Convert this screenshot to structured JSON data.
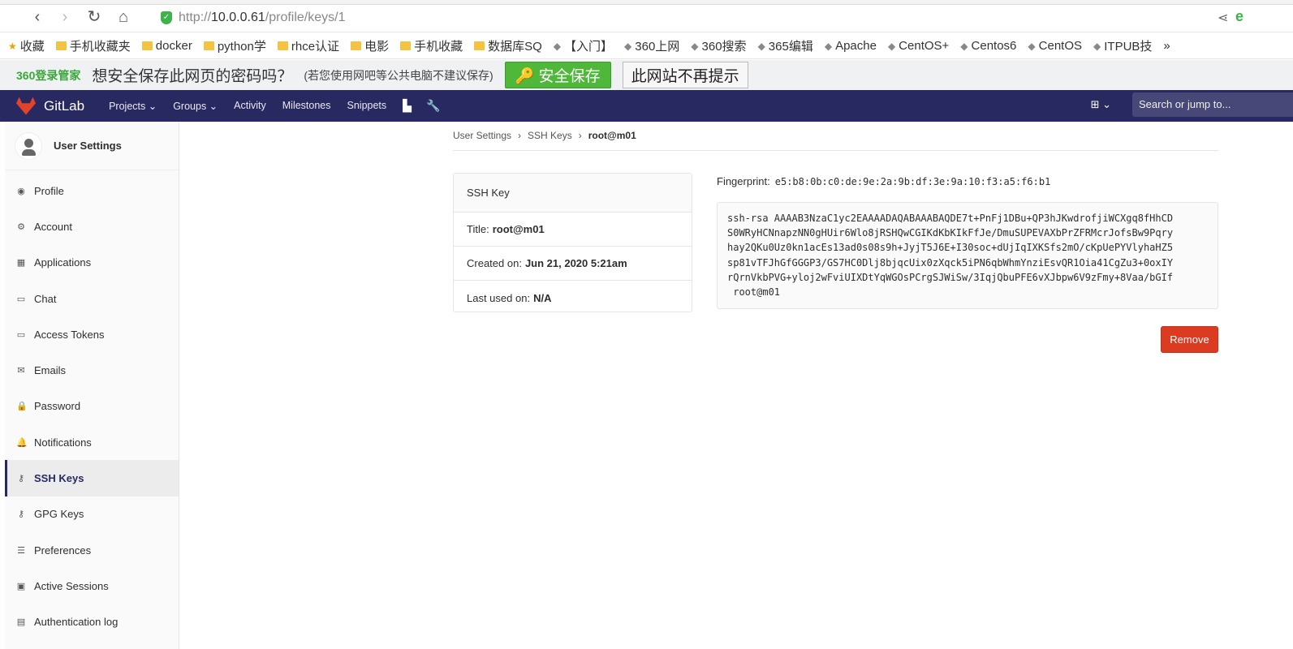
{
  "browser": {
    "url_proto": "http://",
    "url_host": "10.0.0.61",
    "url_path": "/profile/keys/1",
    "bookmarks": [
      "收藏",
      "手机收藏夹",
      "docker",
      "python学",
      "rhce认证",
      "电影",
      "手机收藏",
      "数据库SQ",
      "【入门】",
      "360上网",
      "360搜索",
      "365编辑",
      "Apache",
      "CentOS+",
      "Centos6",
      "CentOS",
      "ITPUB技",
      "»"
    ]
  },
  "pwbar": {
    "logo": "360登录管家",
    "question": "想安全保存此网页的密码吗？",
    "hint": "(若您使用网吧等公共电脑不建议保存)",
    "save": "安全保存",
    "never": "此网站不再提示"
  },
  "navbar": {
    "brand": "GitLab",
    "menu": [
      "Projects ⌄",
      "Groups ⌄",
      "Activity",
      "Milestones",
      "Snippets"
    ],
    "search_placeholder": "Search or jump to..."
  },
  "sidebar": {
    "title": "User Settings",
    "items": [
      "Profile",
      "Account",
      "Applications",
      "Chat",
      "Access Tokens",
      "Emails",
      "Password",
      "Notifications",
      "SSH Keys",
      "GPG Keys",
      "Preferences",
      "Active Sessions",
      "Authentication log"
    ]
  },
  "breadcrumb": [
    "User Settings",
    "SSH Keys",
    "root@m01"
  ],
  "card": {
    "header": "SSH Key",
    "title_label": "Title:",
    "title": "root@m01",
    "created_label": "Created on:",
    "created": "Jun 21, 2020 5:21am",
    "last_label": "Last used on:",
    "last": "N/A"
  },
  "fingerprint": {
    "label": "Fingerprint:",
    "value": "e5:b8:0b:c0:de:9e:2a:9b:df:3e:9a:10:f3:a5:f6:b1"
  },
  "key": "ssh-rsa AAAAB3NzaC1yc2EAAAADAQABAAABAQDE7t+PnFj1DBu+QP3hJKwdrofjiWCXgq8fHhCD\nS0WRyHCNnapzNN0gHUir6Wlo8jRSHQwCGIKdKbKIkFfJe/DmuSUPEVAXbPrZFRMcrJofsBw9Pqry\nhay2QKu0Uz0kn1acEs13ad0s08s9h+JyjT5J6E+I30soc+dUjIqIXKSfs2mO/cKpUePYVlyhaHZ5\nsp81vTFJhGfGGGP3/GS7HC0Dlj8bjqcUix0zXqck5iPN6qbWhmYnziEsvQR1Oia41CgZu3+0oxIY\nrQrnVkbPVG+yloj2wFviUIXDtYqWGOsPCrgSJWiSw/3IqjQbuPFE6vXJbpw6V9zFmy+8Vaa/bGIf\n root@m01",
  "remove": "Remove"
}
